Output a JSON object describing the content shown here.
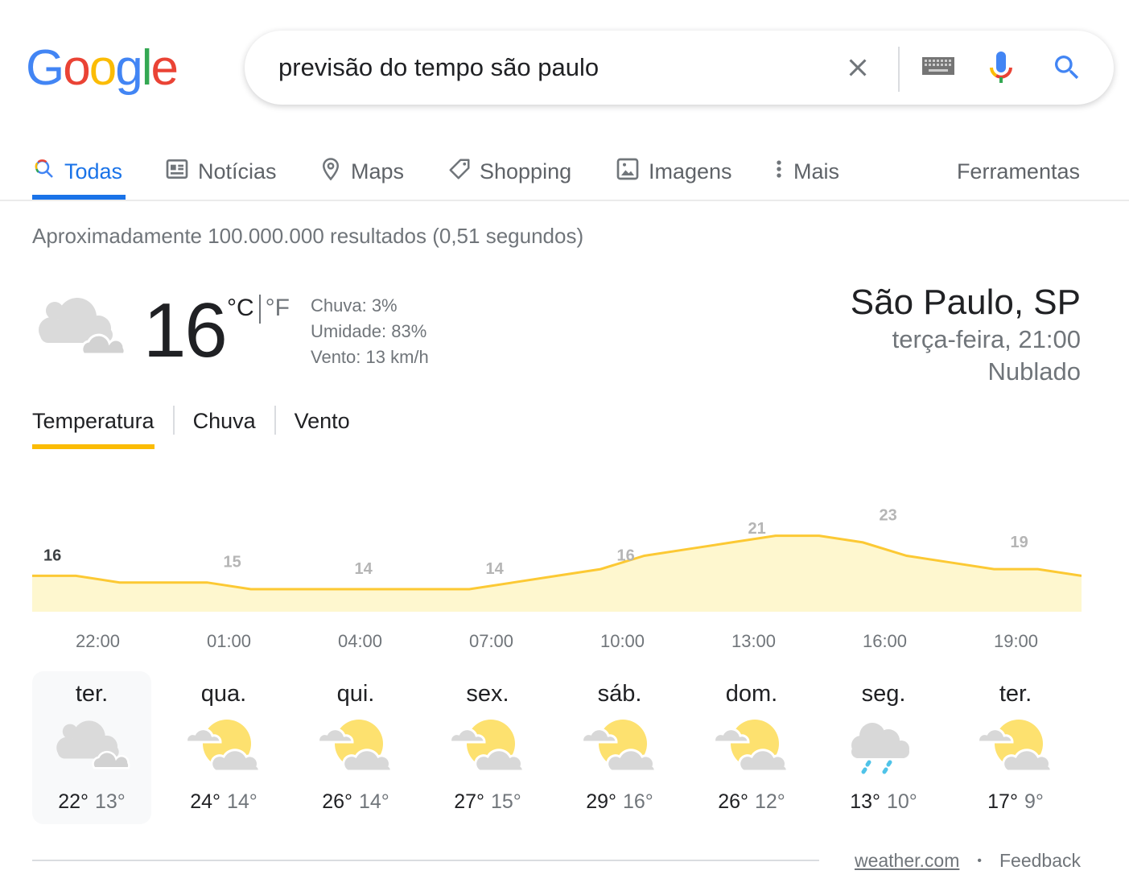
{
  "logo": {
    "letters": [
      {
        "char": "G",
        "color": "#4285f4"
      },
      {
        "char": "o",
        "color": "#ea4335"
      },
      {
        "char": "o",
        "color": "#fbbc05"
      },
      {
        "char": "g",
        "color": "#4285f4"
      },
      {
        "char": "l",
        "color": "#34a853"
      },
      {
        "char": "e",
        "color": "#ea4335"
      }
    ]
  },
  "search": {
    "query": "previsão do tempo são paulo",
    "icons": [
      "clear-icon",
      "keyboard-icon",
      "mic-icon",
      "search-icon"
    ]
  },
  "nav": {
    "tabs": [
      {
        "label": "Todas",
        "icon": "search-icon",
        "active": true
      },
      {
        "label": "Notícias",
        "icon": "news-icon"
      },
      {
        "label": "Maps",
        "icon": "map-pin-icon"
      },
      {
        "label": "Shopping",
        "icon": "tag-icon"
      },
      {
        "label": "Imagens",
        "icon": "image-icon"
      },
      {
        "label": "Mais",
        "icon": "more-vert-icon"
      }
    ],
    "tools": "Ferramentas"
  },
  "stats": "Aproximadamente 100.000.000 resultados (0,51 segundos)",
  "weather": {
    "current_temp": "16",
    "unit_c": "°C",
    "unit_f": "°F",
    "condition_icon": "cloudy-icon",
    "details": {
      "rain": "Chuva: 3%",
      "humidity": "Umidade: 83%",
      "wind": "Vento: 13 km/h"
    },
    "location": "São Paulo, SP",
    "datetime": "terça-feira, 21:00",
    "condition": "Nublado",
    "tabs": [
      {
        "label": "Temperatura",
        "active": true
      },
      {
        "label": "Chuva"
      },
      {
        "label": "Vento"
      }
    ],
    "days": [
      {
        "name": "ter.",
        "icon": "cloudy-icon",
        "hi": "22°",
        "lo": "13°",
        "selected": true
      },
      {
        "name": "qua.",
        "icon": "partly-cloudy-icon",
        "hi": "24°",
        "lo": "14°"
      },
      {
        "name": "qui.",
        "icon": "partly-cloudy-icon",
        "hi": "26°",
        "lo": "14°"
      },
      {
        "name": "sex.",
        "icon": "partly-cloudy-icon",
        "hi": "27°",
        "lo": "15°"
      },
      {
        "name": "sáb.",
        "icon": "partly-cloudy-icon",
        "hi": "29°",
        "lo": "16°"
      },
      {
        "name": "dom.",
        "icon": "partly-cloudy-icon",
        "hi": "26°",
        "lo": "12°"
      },
      {
        "name": "seg.",
        "icon": "rain-icon",
        "hi": "13°",
        "lo": "10°"
      },
      {
        "name": "ter.",
        "icon": "partly-cloudy-icon",
        "hi": "17°",
        "lo": "9°"
      }
    ],
    "source": "weather.com",
    "feedback": "Feedback"
  },
  "colors": {
    "line": "#fcc934",
    "fill": "#fef7cf",
    "accent_blue": "#1a73e8",
    "tab_yellow": "#fbbc04"
  },
  "chart_data": {
    "type": "area",
    "title": "Temperatura",
    "xlabel": "",
    "ylabel": "°C",
    "x": [
      "22:00",
      "01:00",
      "04:00",
      "07:00",
      "10:00",
      "13:00",
      "16:00",
      "19:00"
    ],
    "labeled_values": [
      16,
      15,
      14,
      14,
      16,
      21,
      23,
      19
    ],
    "hourly_values": [
      16,
      16,
      15,
      15,
      15,
      14,
      14,
      14,
      14,
      14,
      14,
      15,
      16,
      17,
      19,
      20,
      21,
      22,
      22,
      21,
      19,
      18,
      17,
      17,
      16
    ],
    "ylim": [
      0,
      24
    ],
    "grid": false,
    "legend": "none"
  }
}
